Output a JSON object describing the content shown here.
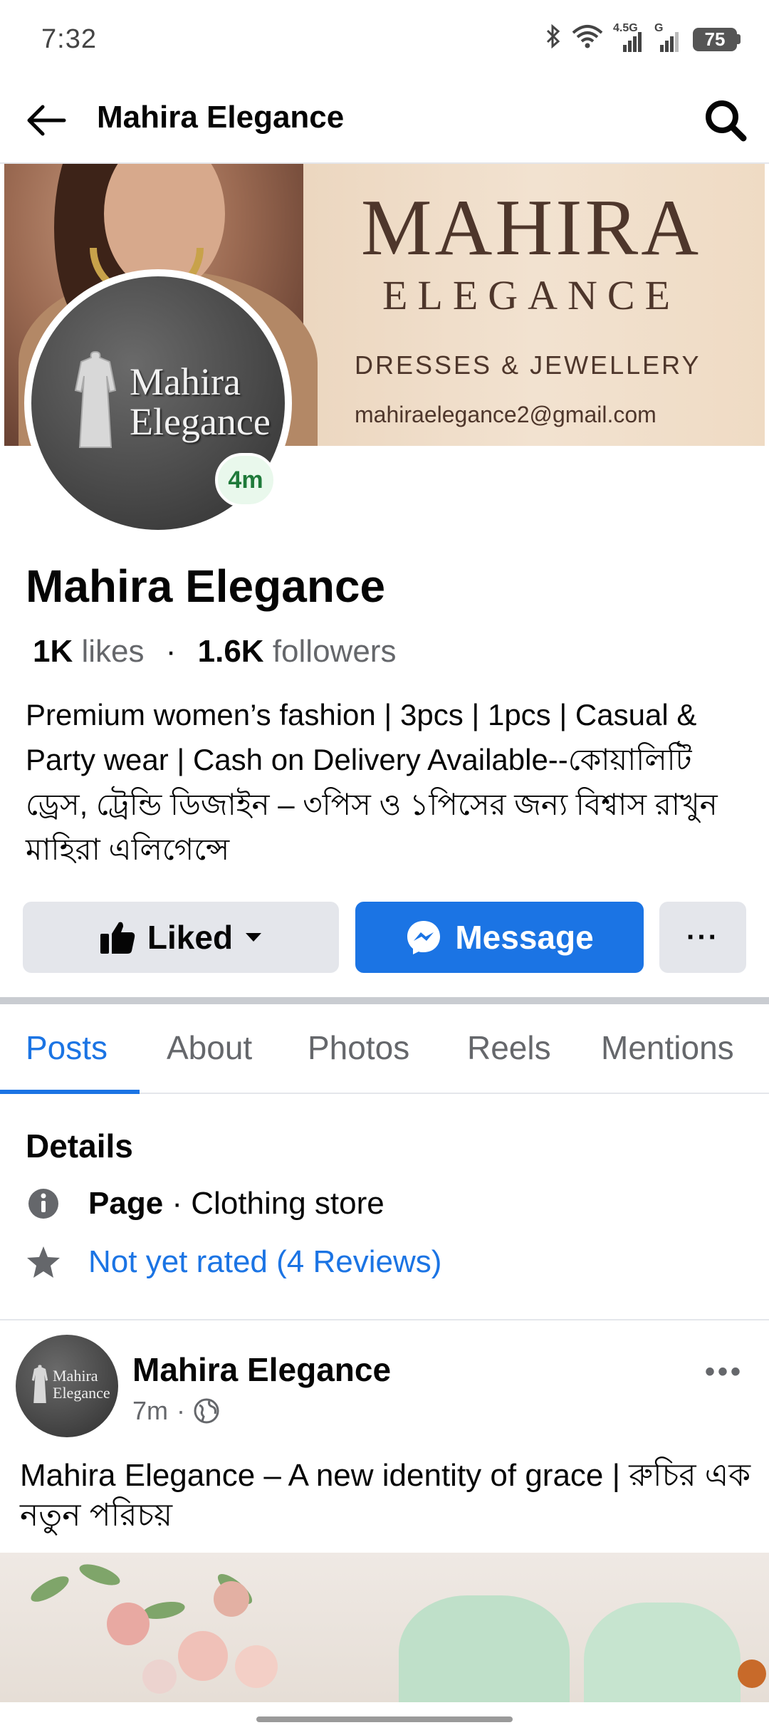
{
  "status_bar": {
    "time": "7:32",
    "network_label": "4.5G",
    "network_label2": "G",
    "battery": "75"
  },
  "header": {
    "title": "Mahira Elegance"
  },
  "cover": {
    "brand_name": "MAHIRA",
    "brand_sub": "ELEGANCE",
    "tagline": "DRESSES & JEWELLERY",
    "email": "mahiraelegance2@gmail.com"
  },
  "avatar": {
    "logo_line1": "Mahira",
    "logo_line2": "Elegance",
    "story_badge": "4m"
  },
  "page": {
    "name": "Mahira Elegance",
    "likes_count": "1K",
    "likes_label": "likes",
    "separator": "·",
    "followers_count": "1.6K",
    "followers_label": "followers",
    "bio": "Premium women’s fashion | 3pcs | 1pcs | Casual & Party wear | Cash on Delivery Available--কোয়ালিটি ড্রেস, ট্রেন্ডি ডিজাইন – ৩পিস ও ১পিসের জন্য বিশ্বাস রাখুন মাহিরা এলিগেন্সে"
  },
  "actions": {
    "liked_label": "Liked",
    "message_label": "Message",
    "more_label": "···"
  },
  "tabs": [
    {
      "label": "Posts"
    },
    {
      "label": "About"
    },
    {
      "label": "Photos"
    },
    {
      "label": "Reels"
    },
    {
      "label": "Mentions"
    }
  ],
  "details": {
    "title": "Details",
    "page_type_bold": "Page",
    "page_type_rest": " · Clothing store",
    "rating_link": "Not yet rated (4 Reviews)"
  },
  "post": {
    "author": "Mahira Elegance",
    "time": "7m",
    "dot": "·",
    "menu": "•••",
    "avatar_line1": "Mahira",
    "avatar_line2": "Elegance",
    "text": "Mahira Elegance – A new identity of grace | রুচির এক নতুন পরিচয়"
  },
  "colors": {
    "accent": "#1b74e4",
    "button_grey": "#e4e6eb",
    "secondary_text": "#65676b",
    "story_badge_bg": "#e9f8ec",
    "story_badge_text": "#1f7a3a"
  }
}
